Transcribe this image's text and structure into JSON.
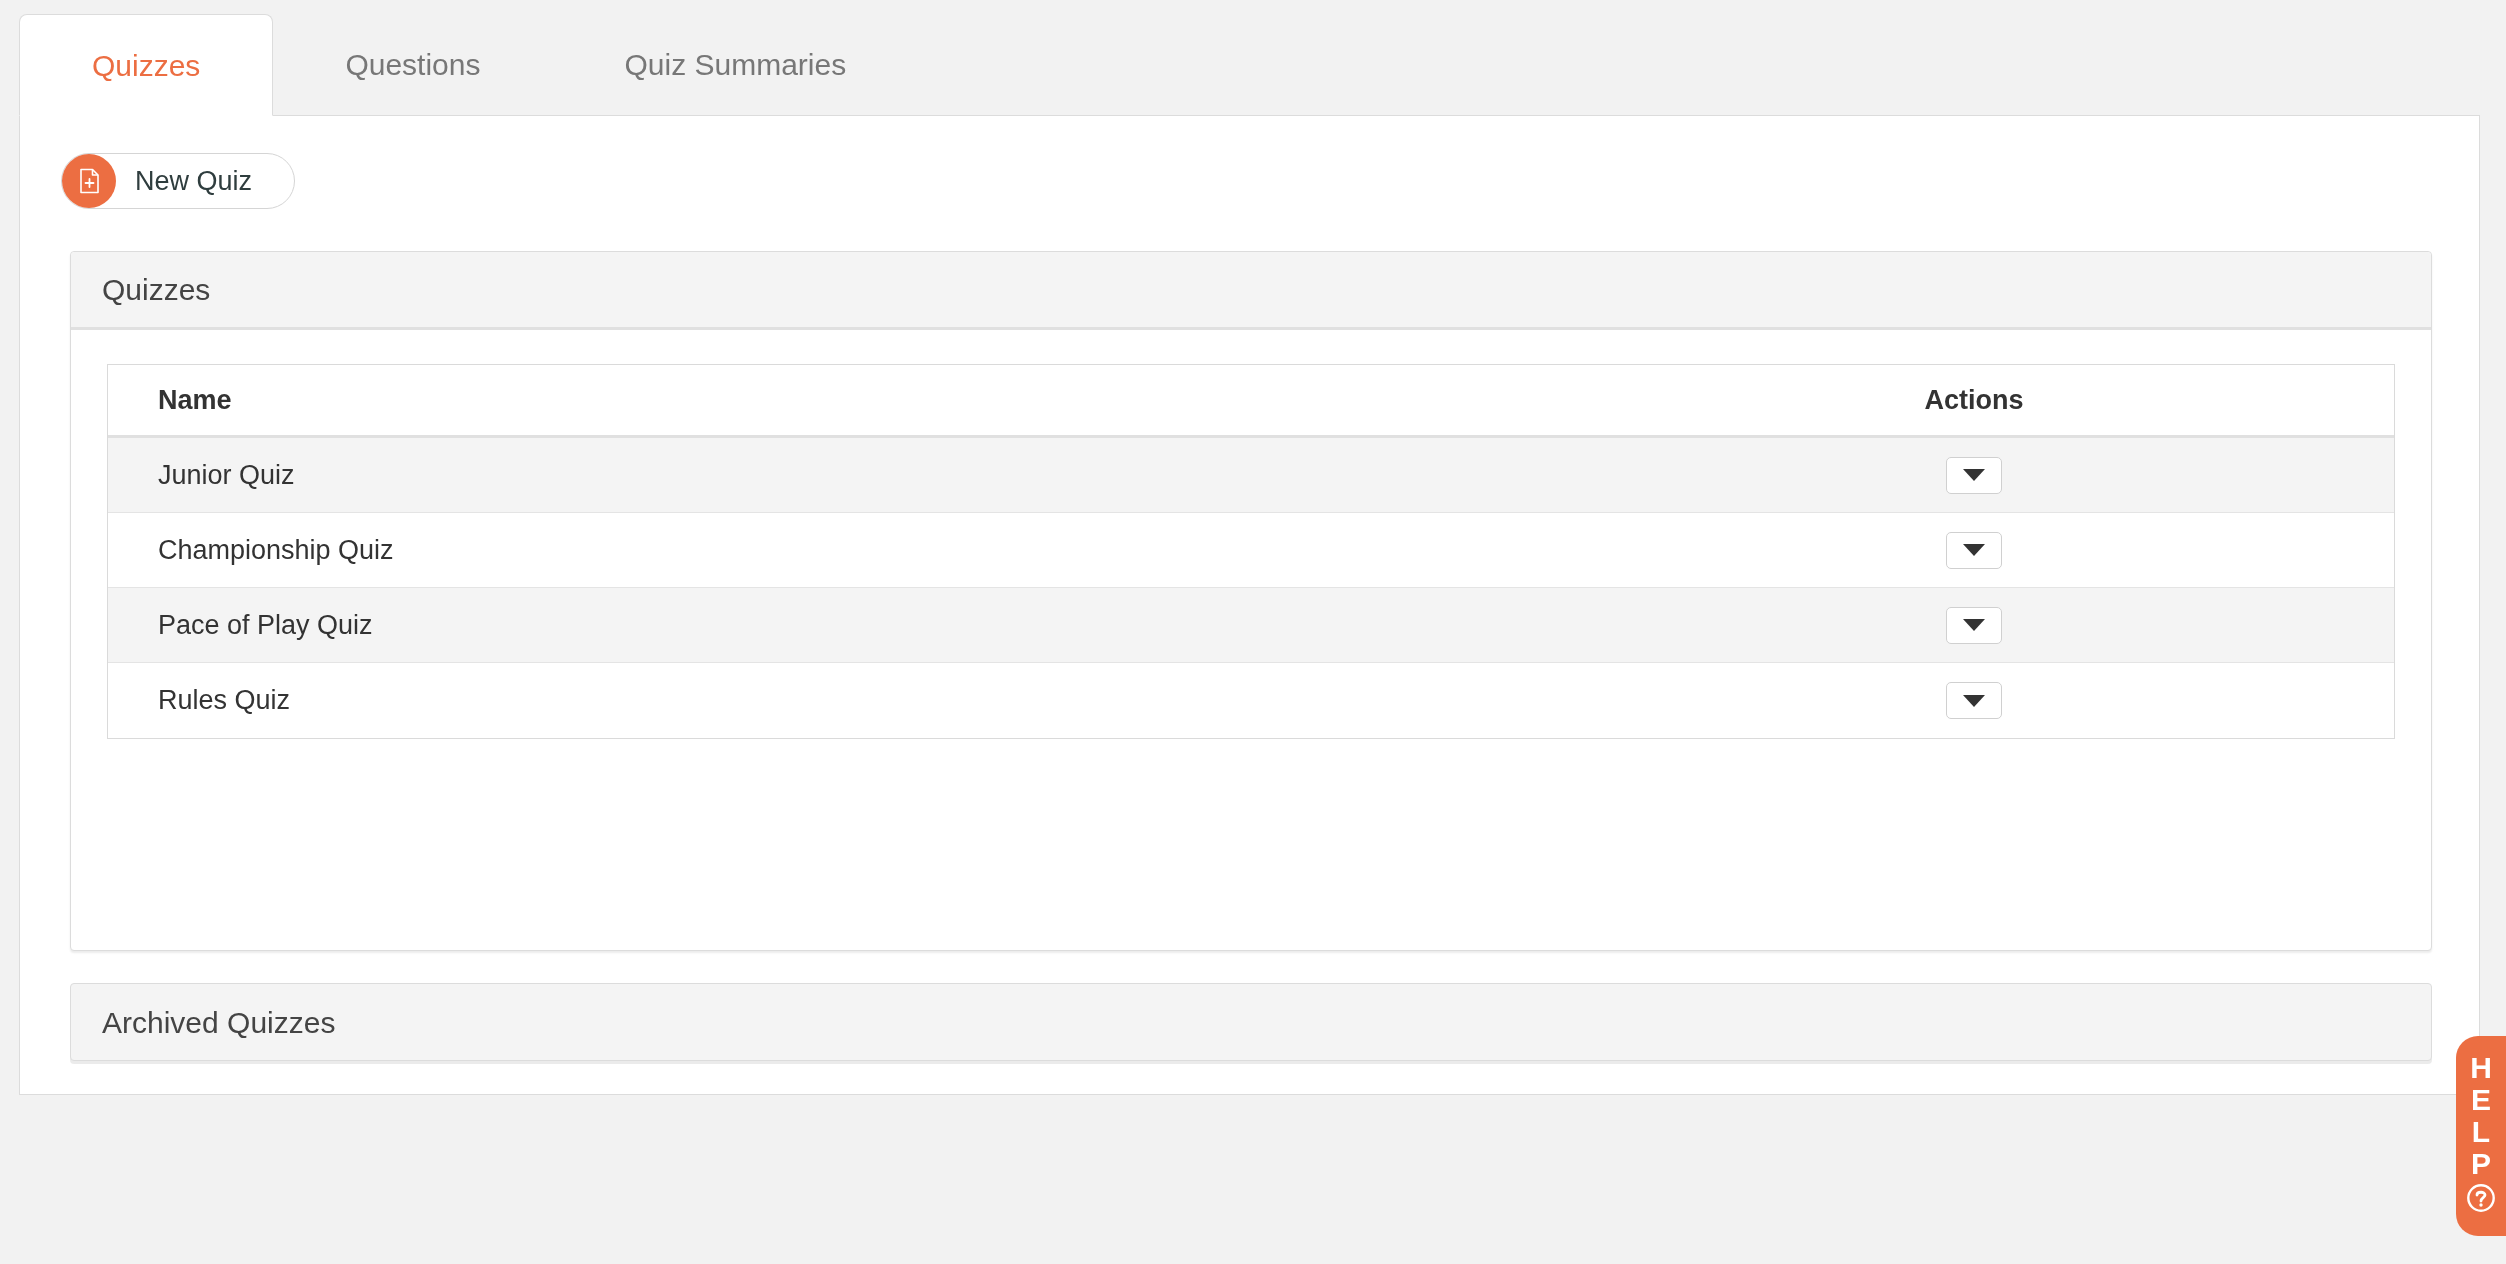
{
  "tabs": [
    {
      "label": "Quizzes",
      "selected": true
    },
    {
      "label": "Questions",
      "selected": false
    },
    {
      "label": "Quiz Summaries",
      "selected": false
    }
  ],
  "toolbar": {
    "new_button": {
      "label": "New Quiz"
    }
  },
  "quizzes_panel": {
    "title": "Quizzes",
    "table": {
      "columns": [
        "Name",
        "Actions"
      ],
      "rows": [
        {
          "name": "Junior Quiz"
        },
        {
          "name": "Championship Quiz"
        },
        {
          "name": "Pace of Play Quiz"
        },
        {
          "name": "Rules Quiz"
        }
      ]
    }
  },
  "archived_panel": {
    "title": "Archived Quizzes"
  },
  "help_tab": {
    "label": "HELP"
  }
}
